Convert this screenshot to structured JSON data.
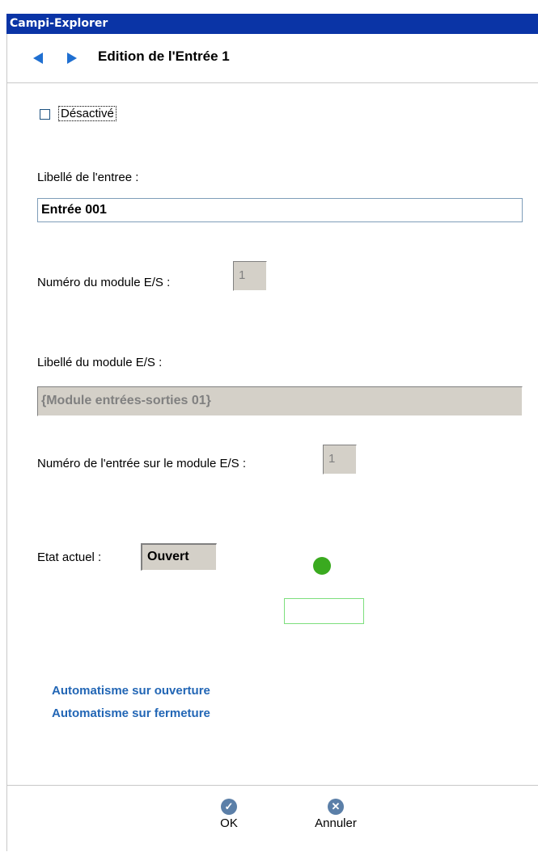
{
  "window": {
    "title": "Campi-Explorer"
  },
  "nav": {
    "title": "Edition de l'Entrée 1",
    "back_icon": "arrow-left-icon",
    "forward_icon": "arrow-right-icon"
  },
  "form": {
    "disabled": {
      "label": "Désactivé",
      "checked": false
    },
    "entry_label": {
      "label": "Libellé de l'entree :",
      "value": "Entrée 001"
    },
    "module_number": {
      "label": "Numéro du module E/S :",
      "value": "1"
    },
    "module_label": {
      "label": "Libellé du module E/S :",
      "value": "{Module entrées-sorties 01}"
    },
    "input_number": {
      "label": "Numéro de l'entrée sur le module E/S :",
      "value": "1"
    },
    "state": {
      "label": "Etat actuel :",
      "value": "Ouvert",
      "led_color": "#3aaa1f"
    }
  },
  "links": {
    "on_open": "Automatisme sur ouverture",
    "on_close": "Automatisme sur fermeture"
  },
  "footer": {
    "ok_label": "OK",
    "cancel_label": "Annuler"
  },
  "colors": {
    "title_bar": "#0a34a6",
    "link": "#2266b5",
    "nav_arrow": "#1f6fd1"
  }
}
